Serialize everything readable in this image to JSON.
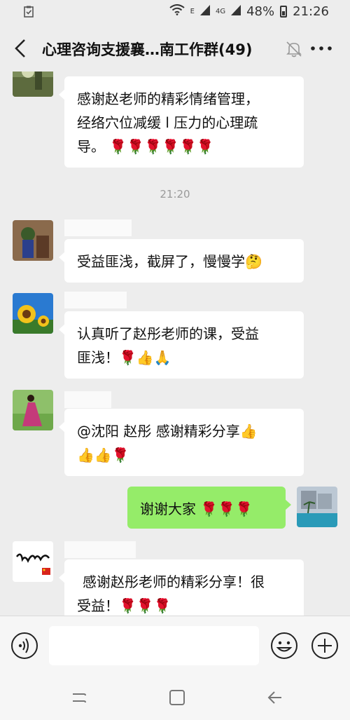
{
  "status_bar": {
    "left_icon": "clipboard-check-icon",
    "network_small": "E",
    "network_4g": "4G",
    "battery": "48%",
    "time": "21:26"
  },
  "header": {
    "title": "心理咨询支援襄…南工作群(49)",
    "back_icon": "chevron-left-icon",
    "mute_icon": "bell-off-icon",
    "more_icon": "more-dots-icon"
  },
  "chat": {
    "timestamp": "21:20",
    "messages": [
      {
        "sender": "other",
        "avatar": "avatar-photo-1",
        "text_line1": "感谢赵老师的精彩情绪管理，",
        "text_line2": "经络穴位减缓 l 压力的心理疏",
        "text_line3": "导。",
        "emoji": "🌹🌹🌹🌹🌹🌹"
      },
      {
        "sender": "other",
        "avatar": "avatar-photo-2",
        "text": "受益匪浅，截屏了，慢慢学",
        "emoji": "🤔"
      },
      {
        "sender": "other",
        "avatar": "avatar-sunflower",
        "text_line1": "认真听了赵彤老师的课，受益",
        "text_line2": "匪浅！",
        "emoji": "🌹👍🙏"
      },
      {
        "sender": "other",
        "avatar": "avatar-woman-field",
        "text_line1": "@沈阳 赵彤  感谢精彩分享",
        "emoji_line1": "👍",
        "emoji_line2": "👍👍🌹"
      },
      {
        "sender": "me",
        "avatar": "avatar-pool",
        "text": "谢谢大家",
        "emoji": "🌹🌹🌹"
      },
      {
        "sender": "other",
        "avatar": "avatar-calligraphy",
        "text_line1": "感谢赵彤老师的精彩分享！很",
        "text_line2": "受益！",
        "emoji": "🌹🌹🌹"
      }
    ]
  },
  "input_bar": {
    "voice_icon": "voice-icon",
    "input_value": "",
    "emoji_icon": "emoji-icon",
    "plus_icon": "plus-icon"
  },
  "nav_bar": {
    "recent_icon": "recent-apps-icon",
    "home_icon": "home-icon",
    "back_icon": "back-arrow-icon"
  }
}
